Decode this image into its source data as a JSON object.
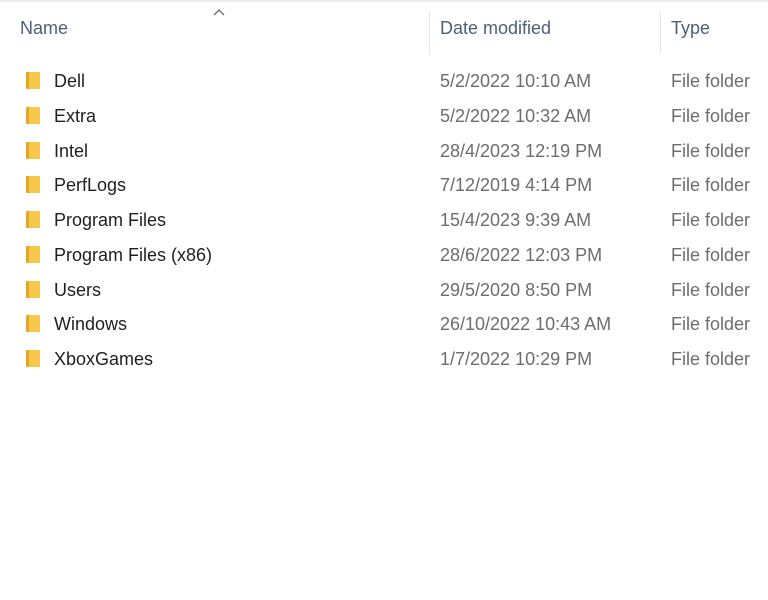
{
  "columns": {
    "name": "Name",
    "date_modified": "Date modified",
    "type": "Type"
  },
  "colors": {
    "header_text": "#4c607a",
    "folder_yellow": "#f8c84a",
    "folder_shadow": "#e4a52b",
    "row_name_text": "#1f1f1f",
    "row_meta_text": "#6d6d6d"
  },
  "rows": [
    {
      "name": "Dell",
      "date": "5/2/2022 10:10 AM",
      "type": "File folder",
      "icon": "folder-icon"
    },
    {
      "name": "Extra",
      "date": "5/2/2022 10:32 AM",
      "type": "File folder",
      "icon": "folder-icon"
    },
    {
      "name": "Intel",
      "date": "28/4/2023 12:19 PM",
      "type": "File folder",
      "icon": "folder-icon"
    },
    {
      "name": "PerfLogs",
      "date": "7/12/2019 4:14 PM",
      "type": "File folder",
      "icon": "folder-icon"
    },
    {
      "name": "Program Files",
      "date": "15/4/2023 9:39 AM",
      "type": "File folder",
      "icon": "folder-icon"
    },
    {
      "name": "Program Files (x86)",
      "date": "28/6/2022 12:03 PM",
      "type": "File folder",
      "icon": "folder-icon"
    },
    {
      "name": "Users",
      "date": "29/5/2020 8:50 PM",
      "type": "File folder",
      "icon": "folder-icon"
    },
    {
      "name": "Windows",
      "date": "26/10/2022 10:43 AM",
      "type": "File folder",
      "icon": "folder-icon"
    },
    {
      "name": "XboxGames",
      "date": "1/7/2022 10:29 PM",
      "type": "File folder",
      "icon": "folder-icon"
    }
  ]
}
